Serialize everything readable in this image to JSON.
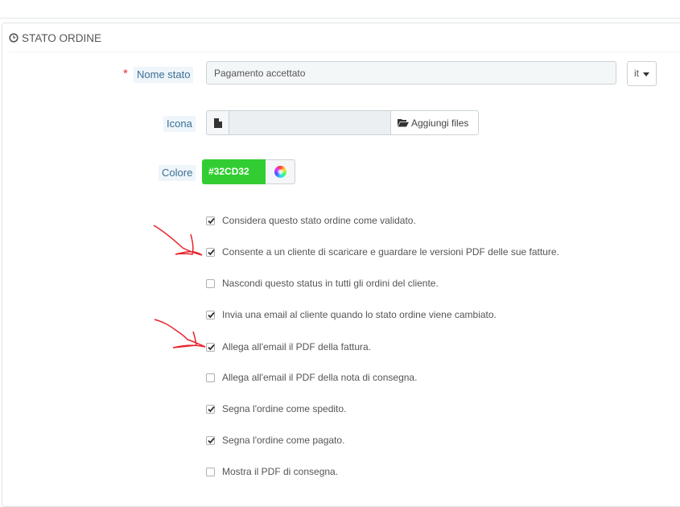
{
  "panel": {
    "title": "STATO ORDINE"
  },
  "form": {
    "name": {
      "label": "Nome stato",
      "required_mark": "*",
      "value": "Pagamento accettato",
      "lang": "it"
    },
    "icon": {
      "label": "Icona",
      "add_button": "Aggiungi files"
    },
    "color": {
      "label": "Colore",
      "value": "#32CD32",
      "swatch": "#32cd32"
    }
  },
  "options": [
    {
      "label": "Considera questo stato ordine come validato.",
      "checked": true
    },
    {
      "label": "Consente a un cliente di scaricare e guardare le versioni PDF delle sue fatture.",
      "checked": true
    },
    {
      "label": "Nascondi questo status in tutti gli ordini del cliente.",
      "checked": false
    },
    {
      "label": "Invia una email al cliente quando lo stato ordine viene cambiato.",
      "checked": true
    },
    {
      "label": "Allega all'email il PDF della fattura.",
      "checked": true
    },
    {
      "label": "Allega all'email il PDF della nota di consegna.",
      "checked": false
    },
    {
      "label": "Segna l'ordine come spedito.",
      "checked": true
    },
    {
      "label": "Segna l'ordine come pagato.",
      "checked": true
    },
    {
      "label": "Mostra il PDF di consegna.",
      "checked": false
    }
  ],
  "annotations": {
    "color": "#e8222a"
  }
}
